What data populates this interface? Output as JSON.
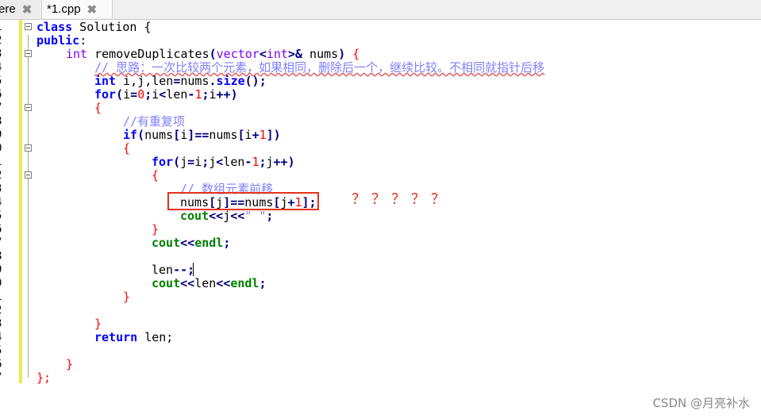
{
  "tabs": [
    {
      "label": "ere",
      "close": "✖"
    },
    {
      "label": "*1.cpp",
      "close": "✖"
    }
  ],
  "line_numbers": [
    "1",
    "2",
    "3",
    "4",
    "5",
    "6",
    "7",
    "8",
    "9",
    "0",
    "1",
    "2",
    "3",
    "4",
    "5",
    "6",
    "7",
    "8",
    "9",
    "0",
    "1",
    "2",
    "3",
    "4",
    "5",
    "6",
    "7"
  ],
  "code": {
    "l1": {
      "kw": "class",
      "rest": " Solution {"
    },
    "l2": {
      "kw": "public",
      "rest": ":"
    },
    "l3": {
      "type": "int",
      "name": " removeDuplicates",
      "p1": "(",
      "vec": "vector",
      "lt": "<",
      "int": "int",
      "gt": ">",
      "amp": "&",
      "param": " nums",
      "p2": ")",
      "brace": " {"
    },
    "l4": {
      "comment": "// 思路：一次比较两个元素，如果相同，删除后一个，继续比较。不相同就指针后移"
    },
    "l5": {
      "type": "int",
      "rest": " i,j,len",
      "eq": "=",
      "obj": "nums",
      "dot": ".",
      "fn": "size",
      "call": "()",
      "semi": ";"
    },
    "l6": {
      "kw": "for",
      "a": "(",
      "b": "i",
      "c": "=",
      "d": "0",
      "e": ";",
      "f": "i",
      "g": "<",
      "h": "len",
      "i": "-",
      "j": "1",
      "k": ";",
      "l": "i",
      "m": "++",
      "n": ")"
    },
    "l7": {
      "brace": "{"
    },
    "l8": {
      "comment": "//有重复项"
    },
    "l9": {
      "kw": "if",
      "a": "(",
      "b": "nums",
      "c": "[",
      "d": "i",
      "e": "]",
      "f": "==",
      "g": "nums",
      "h": "[",
      "i": "i",
      "j": "+",
      "k": "1",
      "l": "])"
    },
    "l10": {
      "brace": "{"
    },
    "l11": {
      "kw": "for",
      "a": "(",
      "b": "j",
      "c": "=",
      "d": "i",
      "e": ";",
      "f": "j",
      "g": "<",
      "h": "len",
      "i": "-",
      "j": "1",
      "k": ";",
      "l": "j",
      "m": "++",
      "n": ")"
    },
    "l12": {
      "brace": "{"
    },
    "l13": {
      "comment": "// 数组元素前移"
    },
    "l14": {
      "a": "nums",
      "b": "[",
      "c": "j",
      "d": "]",
      "e": "==",
      "f": "nums",
      "g": "[",
      "h": "j",
      "i": "+",
      "j": "1",
      "k": "];"
    },
    "l15": {
      "kw": "cout",
      "a": "<<",
      "b": "j",
      "c": "<<",
      "d": "\" \"",
      "e": ";"
    },
    "l16": {
      "brace": "}"
    },
    "l17": {
      "kw": "cout",
      "a": "<<",
      "b": "endl",
      "c": ";"
    },
    "l18": {
      "text": ""
    },
    "l19": {
      "a": "len",
      "b": "--;"
    },
    "l20": {
      "kw": "cout",
      "a": "<<",
      "b": "len",
      "c": "<<",
      "d": "endl",
      "e": ";"
    },
    "l21": {
      "brace": "}"
    },
    "l22": {
      "text": ""
    },
    "l23": {
      "brace": "}"
    },
    "l24": {
      "kw": "return",
      "rest": " len;"
    },
    "l25": {
      "text": ""
    },
    "l26": {
      "brace": "}"
    },
    "l27": {
      "close": "};"
    }
  },
  "annotation": {
    "marks": "？？？？？"
  },
  "watermark": "CSDN @月亮补水",
  "colors": {
    "keyword": "#0000ff",
    "type": "#8000ff",
    "number": "#ff0000",
    "stream": "#008000",
    "comment": "#8080ff",
    "highlight_box": "#e5321c",
    "margin_bar": "#f1e64a"
  }
}
